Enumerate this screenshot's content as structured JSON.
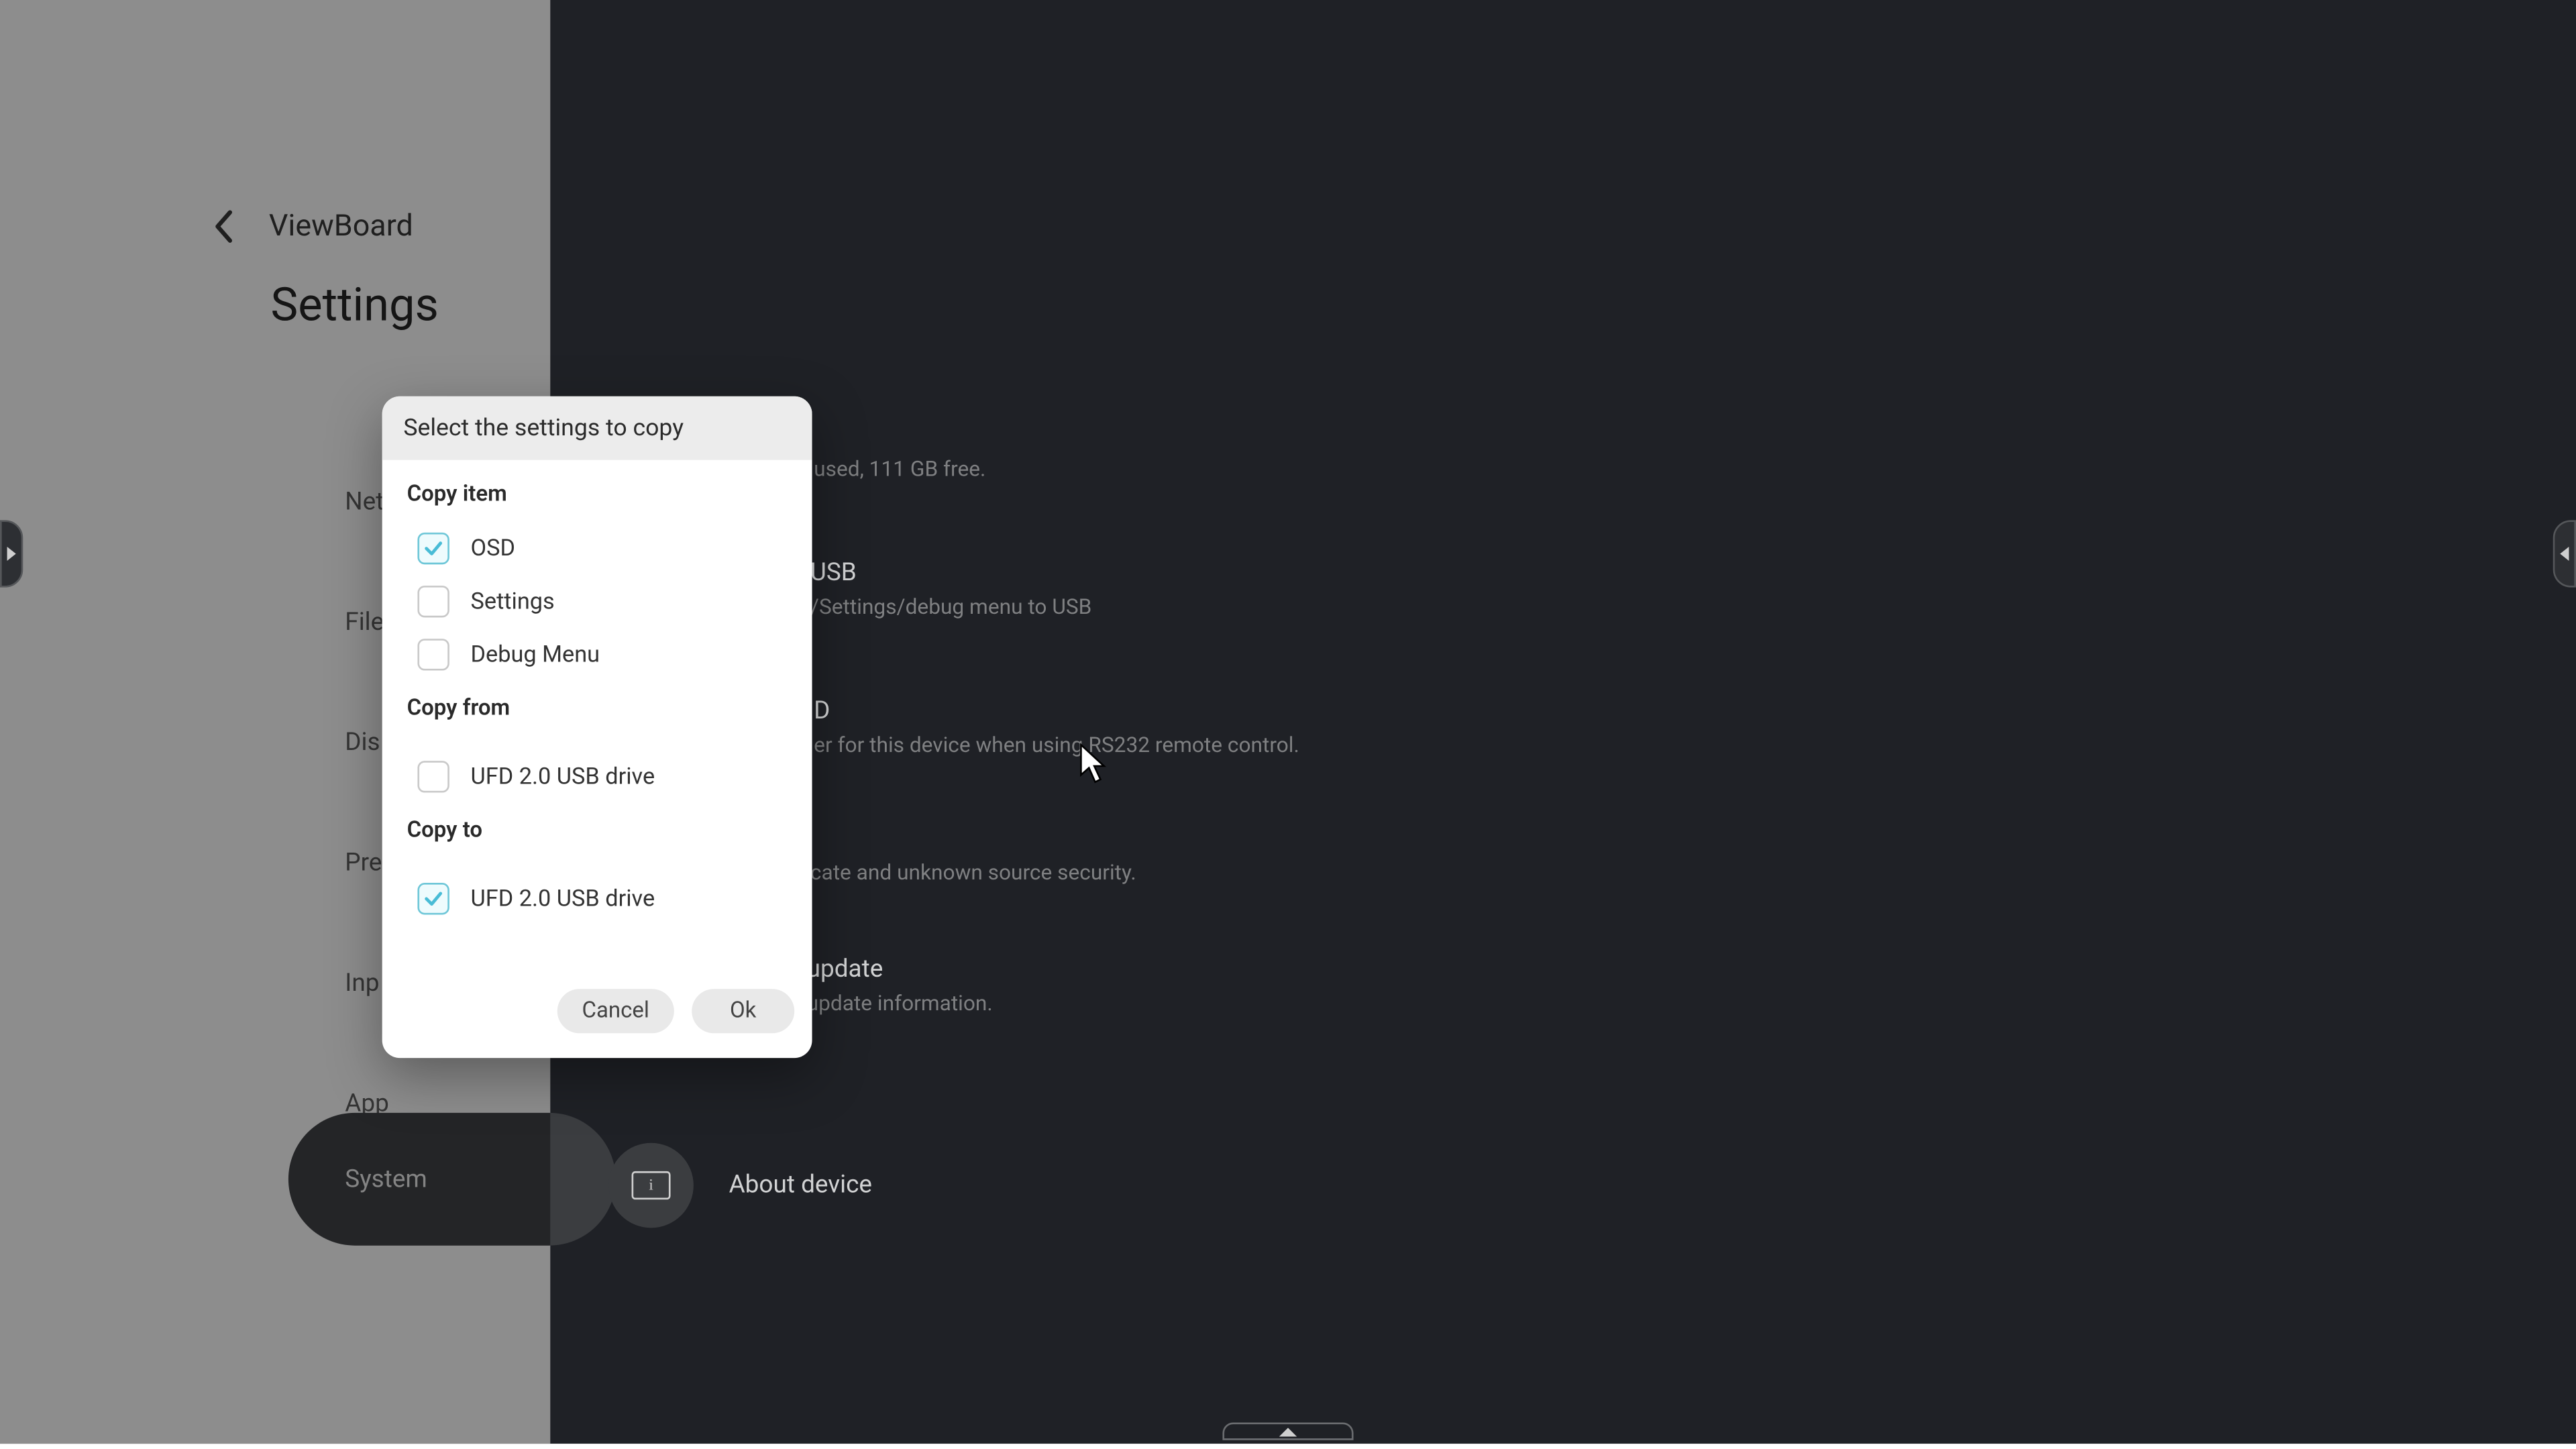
{
  "header": {
    "breadcrumb": "ViewBoard",
    "page_title": "Settings"
  },
  "sidebar": {
    "items": [
      {
        "label": "Net"
      },
      {
        "label": "File"
      },
      {
        "label": "Dis"
      },
      {
        "label": "Pre"
      },
      {
        "label": "Inp"
      },
      {
        "label": "App"
      }
    ],
    "active": {
      "label": "System"
    }
  },
  "content": {
    "storage_line": "used, 111 GB free.",
    "usb_label": "USB",
    "usb_desc": "/Settings/debug menu to USB",
    "menu_letter": "D",
    "rs232_desc": "er for this device when using RS232 remote control.",
    "security_desc": "cate and unknown source security.",
    "update_title": "update",
    "update_desc": "update information.",
    "about_label": "About device"
  },
  "dialog": {
    "title": "Select the settings to copy",
    "groups": {
      "copy_item": {
        "label": "Copy item",
        "options": [
          {
            "label": "OSD",
            "checked": true
          },
          {
            "label": "Settings",
            "checked": false
          },
          {
            "label": "Debug Menu",
            "checked": false
          }
        ]
      },
      "copy_from": {
        "label": "Copy from",
        "options": [
          {
            "label": "UFD 2.0 USB drive",
            "checked": false
          }
        ]
      },
      "copy_to": {
        "label": "Copy to",
        "options": [
          {
            "label": "UFD 2.0 USB drive",
            "checked": true
          }
        ]
      }
    },
    "buttons": {
      "cancel": "Cancel",
      "ok": "Ok"
    }
  }
}
